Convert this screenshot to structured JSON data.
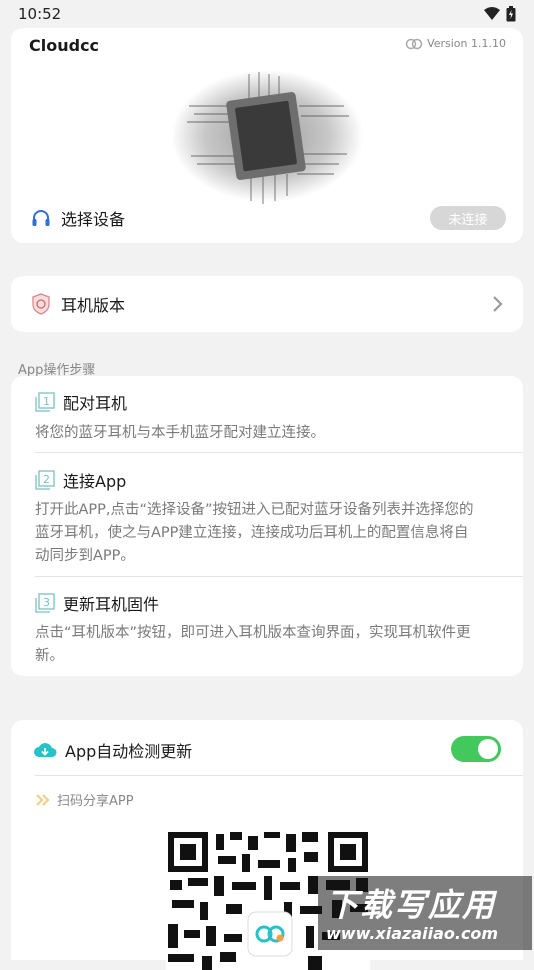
{
  "status_bar": {
    "time": "10:52"
  },
  "header": {
    "app_name": "Cloudcc",
    "version": "Version 1.1.10"
  },
  "device": {
    "select_label": "选择设备",
    "connection_status": "未连接"
  },
  "firmware": {
    "label": "耳机版本"
  },
  "steps_section": {
    "title": "App操作步骤",
    "steps": [
      {
        "number": "1",
        "title": "配对耳机",
        "desc_lines": [
          "将您的蓝牙耳机与本手机蓝牙配对建立连接。"
        ]
      },
      {
        "number": "2",
        "title": "连接App",
        "desc_lines": [
          "打开此APP,点击“选择设备”按钮进入已配对蓝牙设备列表并选择您的",
          "蓝牙耳机，使之与APP建立连接，连接成功后耳机上的配置信息将自",
          "动同步到APP。"
        ]
      },
      {
        "number": "3",
        "title": "更新耳机固件",
        "desc_lines": [
          "点击“耳机版本”按钮，即可进入耳机版本查询界面，实现耳机软件更",
          "新。"
        ]
      }
    ]
  },
  "auto_update": {
    "label": "App自动检测更新",
    "enabled": true
  },
  "share": {
    "label": "扫码分享APP"
  },
  "watermark": {
    "title": "下载写应用",
    "url": "www.xiazaiiao.com"
  },
  "colors": {
    "toggle_on": "#43c85c",
    "accent_blue": "#2f6fd6",
    "cloud_teal": "#27c2c9"
  }
}
